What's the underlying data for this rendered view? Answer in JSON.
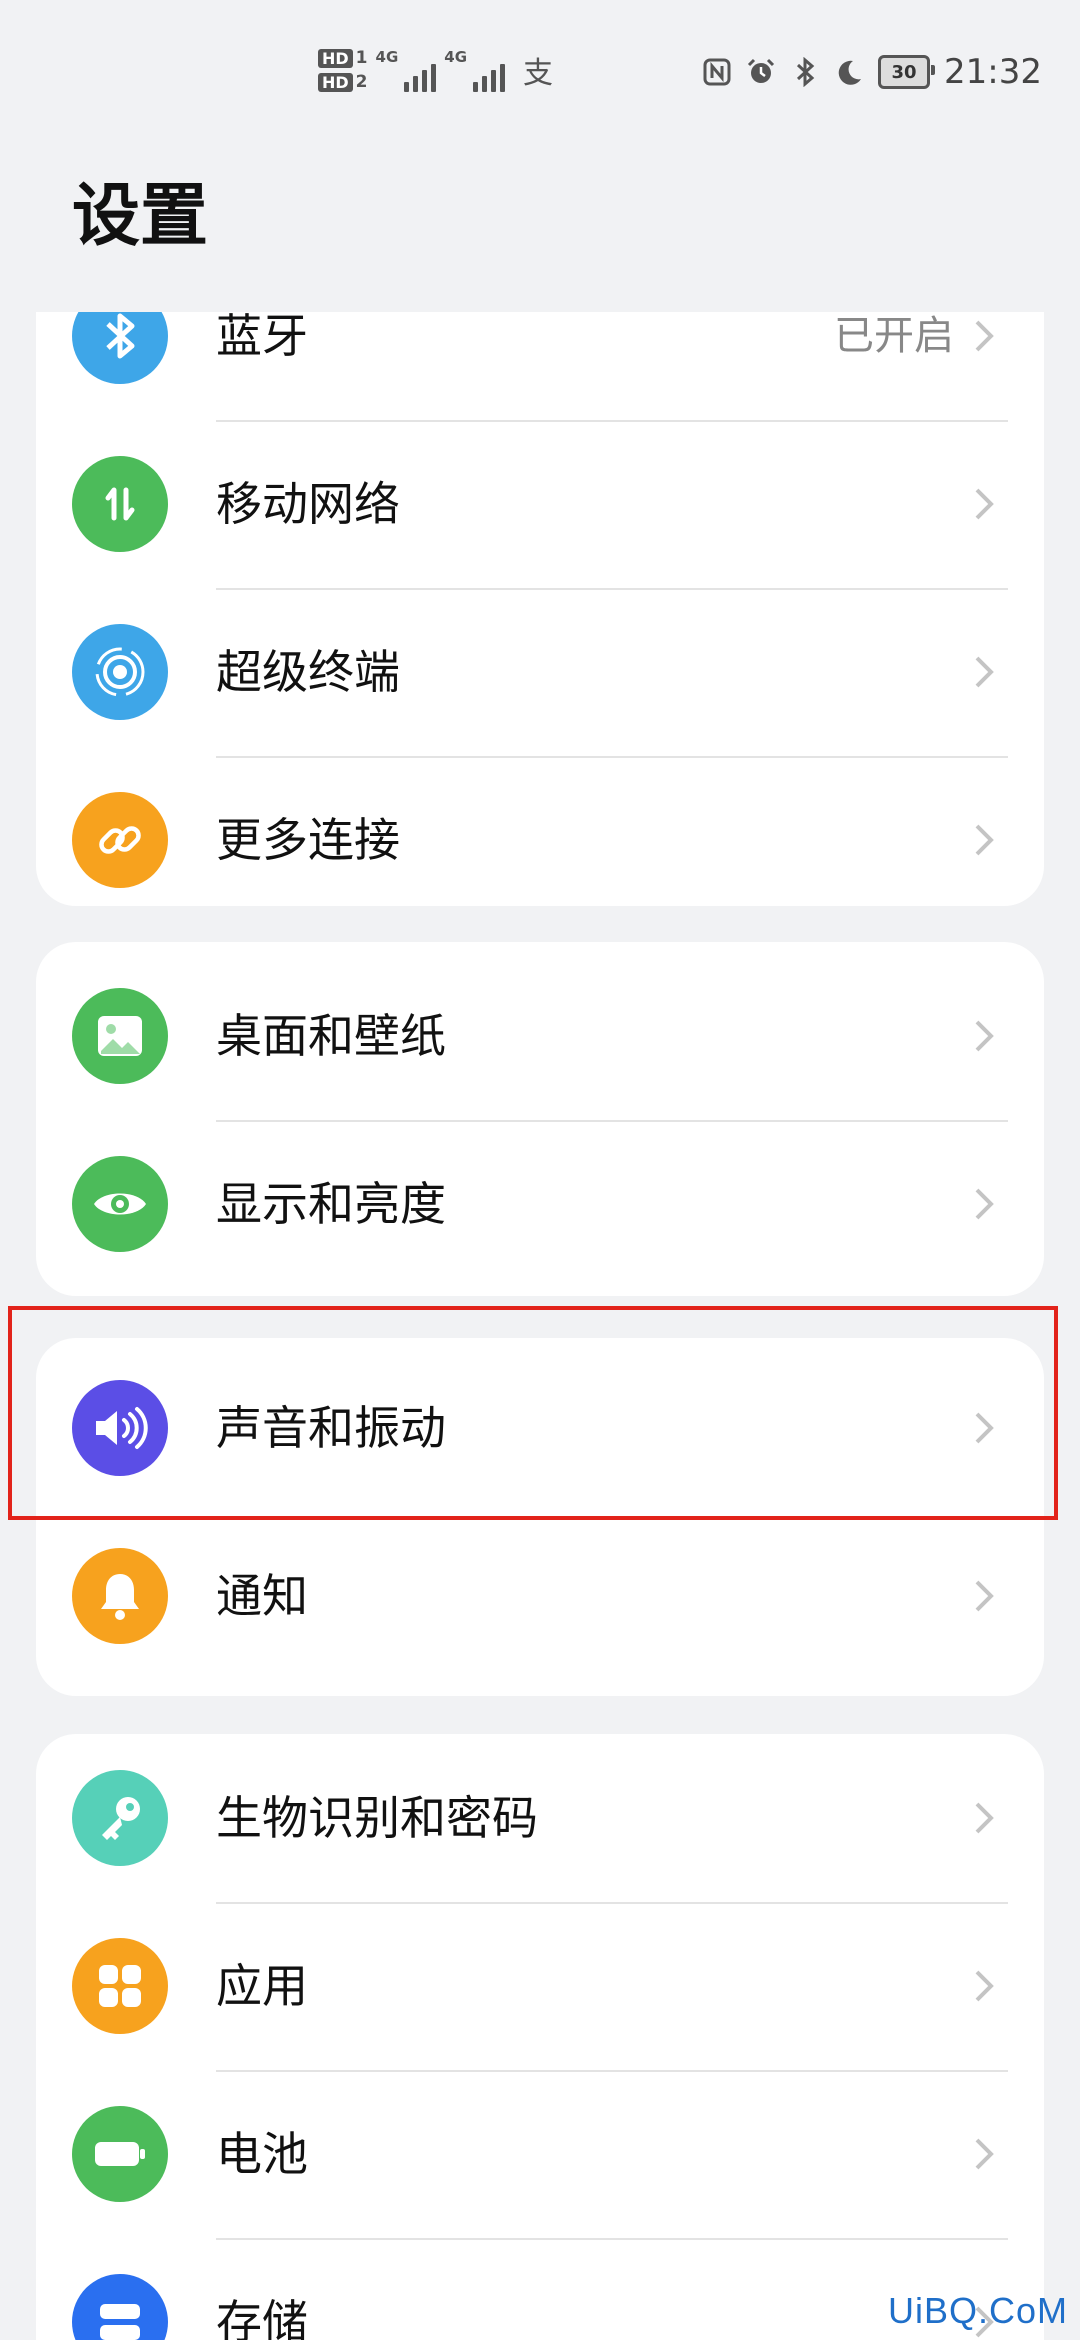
{
  "status_bar": {
    "hd1": "HD",
    "hd1_num": "1",
    "hd2": "HD",
    "hd2_num": "2",
    "net1": "4G",
    "net2": "4G",
    "pay_glyph": "支",
    "battery": "30",
    "time": "21:32",
    "icons": [
      "nfc-icon",
      "alarm-icon",
      "bluetooth-icon",
      "moon-icon"
    ]
  },
  "page": {
    "title": "设置"
  },
  "groups": [
    {
      "items": [
        {
          "label": "蓝牙",
          "value": "已开启",
          "icon": "bluetooth-icon",
          "color": "#3ea6e8"
        },
        {
          "label": "移动网络",
          "icon": "mobile-data-icon",
          "color": "#4cbb5a"
        },
        {
          "label": "超级终端",
          "icon": "super-device-icon",
          "color": "#3ea6e8"
        },
        {
          "label": "更多连接",
          "icon": "link-icon",
          "color": "#f7a21e"
        }
      ]
    },
    {
      "items": [
        {
          "label": "桌面和壁纸",
          "icon": "wallpaper-icon",
          "color": "#4cbb5a"
        },
        {
          "label": "显示和亮度",
          "icon": "eye-icon",
          "color": "#4cbb5a"
        }
      ]
    },
    {
      "items": [
        {
          "label": "声音和振动",
          "icon": "speaker-icon",
          "color": "#5b4ee6"
        },
        {
          "label": "通知",
          "icon": "bell-icon",
          "color": "#f7a21e"
        }
      ]
    },
    {
      "items": [
        {
          "label": "生物识别和密码",
          "icon": "key-icon",
          "color": "#56d0b8"
        },
        {
          "label": "应用",
          "icon": "apps-icon",
          "color": "#f7a21e"
        },
        {
          "label": "电池",
          "icon": "battery-icon",
          "color": "#4cbb5a"
        },
        {
          "label": "存储",
          "icon": "storage-icon",
          "color": "#2a6ff0"
        }
      ]
    }
  ],
  "watermark": "UiBQ.CoM"
}
